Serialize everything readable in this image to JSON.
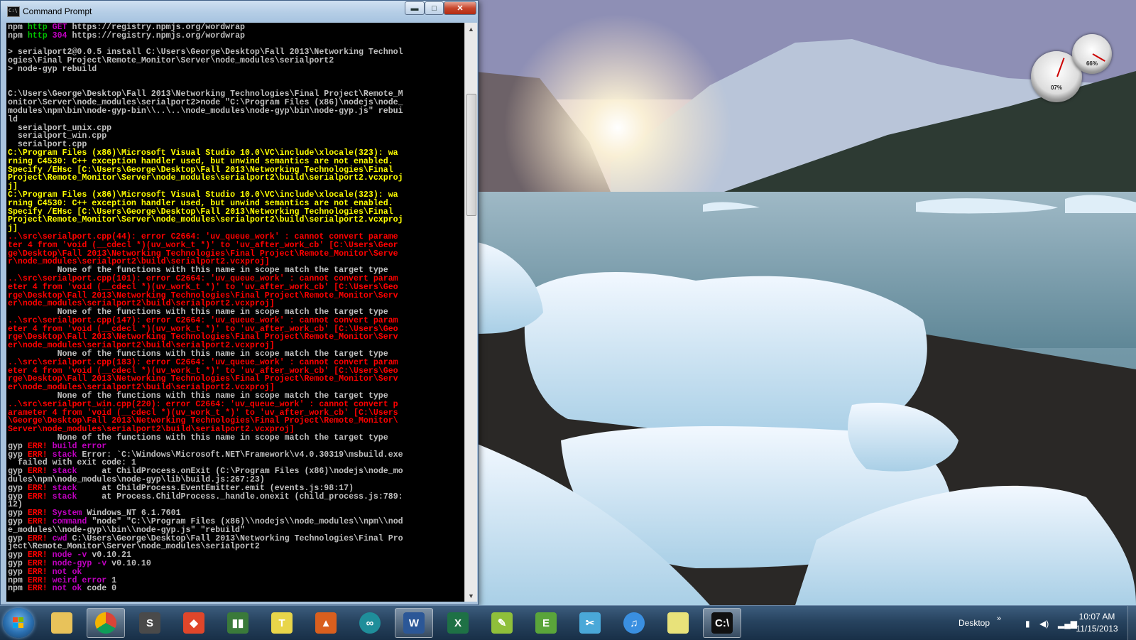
{
  "window": {
    "title": "Command Prompt",
    "minimize_glyph": "▬",
    "maximize_glyph": "□",
    "close_glyph": "✕"
  },
  "console": {
    "lines": [
      [
        [
          "w",
          "npm "
        ],
        [
          "g",
          "http "
        ],
        [
          "m",
          "GET "
        ],
        [
          "w",
          "https://registry.npmjs.org/wordwrap"
        ]
      ],
      [
        [
          "w",
          "npm "
        ],
        [
          "g",
          "http "
        ],
        [
          "m",
          "304 "
        ],
        [
          "w",
          "https://registry.npmjs.org/wordwrap"
        ]
      ],
      [
        [
          "w",
          ""
        ]
      ],
      [
        [
          "w",
          "> serialport2@0.0.5 install C:\\Users\\George\\Desktop\\Fall 2013\\Networking Technol"
        ]
      ],
      [
        [
          "w",
          "ogies\\Final Project\\Remote_Monitor\\Server\\node_modules\\serialport2"
        ]
      ],
      [
        [
          "w",
          "> node-gyp rebuild"
        ]
      ],
      [
        [
          "w",
          ""
        ]
      ],
      [
        [
          "w",
          ""
        ]
      ],
      [
        [
          "w",
          "C:\\Users\\George\\Desktop\\Fall 2013\\Networking Technologies\\Final Project\\Remote_M"
        ]
      ],
      [
        [
          "w",
          "onitor\\Server\\node_modules\\serialport2>node \"C:\\Program Files (x86)\\nodejs\\node_"
        ]
      ],
      [
        [
          "w",
          "modules\\npm\\bin\\node-gyp-bin\\\\..\\..\\node_modules\\node-gyp\\bin\\node-gyp.js\" rebui"
        ]
      ],
      [
        [
          "w",
          "ld"
        ]
      ],
      [
        [
          "w",
          "  serialport_unix.cpp"
        ]
      ],
      [
        [
          "w",
          "  serialport_win.cpp"
        ]
      ],
      [
        [
          "w",
          "  serialport.cpp"
        ]
      ],
      [
        [
          "y",
          "C:\\Program Files (x86)\\Microsoft Visual Studio 10.0\\VC\\include\\xlocale(323): wa"
        ]
      ],
      [
        [
          "y",
          "rning C4530: C++ exception handler used, but unwind semantics are not enabled."
        ]
      ],
      [
        [
          "y",
          "Specify /EHsc [C:\\Users\\George\\Desktop\\Fall 2013\\Networking Technologies\\Final "
        ]
      ],
      [
        [
          "y",
          "Project\\Remote_Monitor\\Server\\node_modules\\serialport2\\build\\serialport2.vcxproj"
        ]
      ],
      [
        [
          "y",
          "j]"
        ]
      ],
      [
        [
          "y",
          "C:\\Program Files (x86)\\Microsoft Visual Studio 10.0\\VC\\include\\xlocale(323): wa"
        ]
      ],
      [
        [
          "y",
          "rning C4530: C++ exception handler used, but unwind semantics are not enabled."
        ]
      ],
      [
        [
          "y",
          "Specify /EHsc [C:\\Users\\George\\Desktop\\Fall 2013\\Networking Technologies\\Final "
        ]
      ],
      [
        [
          "y",
          "Project\\Remote_Monitor\\Server\\node_modules\\serialport2\\build\\serialport2.vcxproj"
        ]
      ],
      [
        [
          "y",
          "j]"
        ]
      ],
      [
        [
          "r",
          "..\\src\\serialport.cpp(44): error C2664: 'uv_queue_work' : cannot convert parame"
        ]
      ],
      [
        [
          "r",
          "ter 4 from 'void (__cdecl *)(uv_work_t *)' to 'uv_after_work_cb' [C:\\Users\\Geor"
        ]
      ],
      [
        [
          "r",
          "ge\\Desktop\\Fall 2013\\Networking Technologies\\Final Project\\Remote_Monitor\\Serve"
        ]
      ],
      [
        [
          "r",
          "r\\node_modules\\serialport2\\build\\serialport2.vcxproj]"
        ]
      ],
      [
        [
          "w",
          "          None of the functions with this name in scope match the target type"
        ]
      ],
      [
        [
          "r",
          "..\\src\\serialport.cpp(101): error C2664: 'uv_queue_work' : cannot convert param"
        ]
      ],
      [
        [
          "r",
          "eter 4 from 'void (__cdecl *)(uv_work_t *)' to 'uv_after_work_cb' [C:\\Users\\Geo"
        ]
      ],
      [
        [
          "r",
          "rge\\Desktop\\Fall 2013\\Networking Technologies\\Final Project\\Remote_Monitor\\Serv"
        ]
      ],
      [
        [
          "r",
          "er\\node_modules\\serialport2\\build\\serialport2.vcxproj]"
        ]
      ],
      [
        [
          "w",
          "          None of the functions with this name in scope match the target type"
        ]
      ],
      [
        [
          "r",
          "..\\src\\serialport.cpp(147): error C2664: 'uv_queue_work' : cannot convert param"
        ]
      ],
      [
        [
          "r",
          "eter 4 from 'void (__cdecl *)(uv_work_t *)' to 'uv_after_work_cb' [C:\\Users\\Geo"
        ]
      ],
      [
        [
          "r",
          "rge\\Desktop\\Fall 2013\\Networking Technologies\\Final Project\\Remote_Monitor\\Serv"
        ]
      ],
      [
        [
          "r",
          "er\\node_modules\\serialport2\\build\\serialport2.vcxproj]"
        ]
      ],
      [
        [
          "w",
          "          None of the functions with this name in scope match the target type"
        ]
      ],
      [
        [
          "r",
          "..\\src\\serialport.cpp(183): error C2664: 'uv_queue_work' : cannot convert param"
        ]
      ],
      [
        [
          "r",
          "eter 4 from 'void (__cdecl *)(uv_work_t *)' to 'uv_after_work_cb' [C:\\Users\\Geo"
        ]
      ],
      [
        [
          "r",
          "rge\\Desktop\\Fall 2013\\Networking Technologies\\Final Project\\Remote_Monitor\\Serv"
        ]
      ],
      [
        [
          "r",
          "er\\node_modules\\serialport2\\build\\serialport2.vcxproj]"
        ]
      ],
      [
        [
          "w",
          "          None of the functions with this name in scope match the target type"
        ]
      ],
      [
        [
          "r",
          "..\\src\\serialport_win.cpp(220): error C2664: 'uv_queue_work' : cannot convert p"
        ]
      ],
      [
        [
          "r",
          "arameter 4 from 'void (__cdecl *)(uv_work_t *)' to 'uv_after_work_cb' [C:\\Users"
        ]
      ],
      [
        [
          "r",
          "\\George\\Desktop\\Fall 2013\\Networking Technologies\\Final Project\\Remote_Monitor\\"
        ]
      ],
      [
        [
          "r",
          "Server\\node_modules\\serialport2\\build\\serialport2.vcxproj]"
        ]
      ],
      [
        [
          "w",
          "          None of the functions with this name in scope match the target type"
        ]
      ],
      [
        [
          "w",
          "gyp "
        ],
        [
          "r",
          "ERR! "
        ],
        [
          "m",
          "build error"
        ]
      ],
      [
        [
          "w",
          "gyp "
        ],
        [
          "r",
          "ERR! "
        ],
        [
          "m",
          "stack "
        ],
        [
          "w",
          "Error: `C:\\Windows\\Microsoft.NET\\Framework\\v4.0.30319\\msbuild.exe"
        ]
      ],
      [
        [
          "w",
          "` failed with exit code: 1"
        ]
      ],
      [
        [
          "w",
          "gyp "
        ],
        [
          "r",
          "ERR! "
        ],
        [
          "m",
          "stack     "
        ],
        [
          "w",
          "at ChildProcess.onExit (C:\\Program Files (x86)\\nodejs\\node_mo"
        ]
      ],
      [
        [
          "w",
          "dules\\npm\\node_modules\\node-gyp\\lib\\build.js:267:23)"
        ]
      ],
      [
        [
          "w",
          "gyp "
        ],
        [
          "r",
          "ERR! "
        ],
        [
          "m",
          "stack     "
        ],
        [
          "w",
          "at ChildProcess.EventEmitter.emit (events.js:98:17)"
        ]
      ],
      [
        [
          "w",
          "gyp "
        ],
        [
          "r",
          "ERR! "
        ],
        [
          "m",
          "stack     "
        ],
        [
          "w",
          "at Process.ChildProcess._handle.onexit (child_process.js:789:"
        ]
      ],
      [
        [
          "w",
          "12)"
        ]
      ],
      [
        [
          "w",
          "gyp "
        ],
        [
          "r",
          "ERR! "
        ],
        [
          "m",
          "System "
        ],
        [
          "w",
          "Windows_NT 6.1.7601"
        ]
      ],
      [
        [
          "w",
          "gyp "
        ],
        [
          "r",
          "ERR! "
        ],
        [
          "m",
          "command "
        ],
        [
          "w",
          "\"node\" \"C:\\\\Program Files (x86)\\\\nodejs\\\\node_modules\\\\npm\\\\nod"
        ]
      ],
      [
        [
          "w",
          "e_modules\\\\node-gyp\\\\bin\\\\node-gyp.js\" \"rebuild\""
        ]
      ],
      [
        [
          "w",
          "gyp "
        ],
        [
          "r",
          "ERR! "
        ],
        [
          "m",
          "cwd "
        ],
        [
          "w",
          "C:\\Users\\George\\Desktop\\Fall 2013\\Networking Technologies\\Final Pro"
        ]
      ],
      [
        [
          "w",
          "ject\\Remote_Monitor\\Server\\node_modules\\serialport2"
        ]
      ],
      [
        [
          "w",
          "gyp "
        ],
        [
          "r",
          "ERR! "
        ],
        [
          "m",
          "node -v "
        ],
        [
          "w",
          "v0.10.21"
        ]
      ],
      [
        [
          "w",
          "gyp "
        ],
        [
          "r",
          "ERR! "
        ],
        [
          "m",
          "node-gyp -v "
        ],
        [
          "w",
          "v0.10.10"
        ]
      ],
      [
        [
          "w",
          "gyp "
        ],
        [
          "r",
          "ERR! "
        ],
        [
          "m",
          "not ok"
        ]
      ],
      [
        [
          "w",
          "npm "
        ],
        [
          "r",
          "ERR! "
        ],
        [
          "m",
          "weird error "
        ],
        [
          "w",
          "1"
        ]
      ],
      [
        [
          "w",
          "npm "
        ],
        [
          "r",
          "ERR! "
        ],
        [
          "m",
          "not ok "
        ],
        [
          "w",
          "code 0"
        ]
      ]
    ]
  },
  "gadget": {
    "cpu_percent": "07%",
    "memory_percent": "66%"
  },
  "taskbar": {
    "items": [
      {
        "name": "explorer",
        "label": "",
        "icon": "folder-icon",
        "color": "#e8c25a",
        "active": false
      },
      {
        "name": "chrome",
        "label": "",
        "icon": "chrome-icon",
        "color": "#e33b2e",
        "active": true
      },
      {
        "name": "sublime",
        "label": "S",
        "icon": "sublime-text-icon",
        "color": "#4a4a4a",
        "active": false
      },
      {
        "name": "git",
        "label": "◆",
        "icon": "git-icon",
        "color": "#e0462a",
        "active": false
      },
      {
        "name": "network",
        "label": "▮▮",
        "icon": "network-monitor-icon",
        "color": "#3a7a3a",
        "active": false
      },
      {
        "name": "textpad",
        "label": "T",
        "icon": "textpad-icon",
        "color": "#e8d54a",
        "active": false
      },
      {
        "name": "matlab",
        "label": "▲",
        "icon": "matlab-icon",
        "color": "#d95f1e",
        "active": false
      },
      {
        "name": "arduino",
        "label": "∞",
        "icon": "arduino-icon",
        "color": "#1f8e9a",
        "active": false
      },
      {
        "name": "word",
        "label": "W",
        "icon": "word-icon",
        "color": "#2b5797",
        "active": true
      },
      {
        "name": "excel",
        "label": "X",
        "icon": "excel-icon",
        "color": "#1e7145",
        "active": false
      },
      {
        "name": "notepad",
        "label": "✎",
        "icon": "notepad-plus-icon",
        "color": "#8fbf3a",
        "active": false
      },
      {
        "name": "evernote",
        "label": "E",
        "icon": "evernote-icon",
        "color": "#5aa53a",
        "active": false
      },
      {
        "name": "snipping",
        "label": "✂",
        "icon": "snipping-tool-icon",
        "color": "#4aa8d8",
        "active": false
      },
      {
        "name": "itunes",
        "label": "♫",
        "icon": "itunes-icon",
        "color": "#3a8fe0",
        "active": false
      },
      {
        "name": "sticky",
        "label": "",
        "icon": "sticky-notes-icon",
        "color": "#e8e27a",
        "active": false
      },
      {
        "name": "cmd",
        "label": "C:\\",
        "icon": "command-prompt-icon",
        "color": "#111111",
        "active": true
      }
    ],
    "desktop_label": "Desktop",
    "chevron": "»",
    "clock_time": "10:07 AM",
    "clock_date": "11/15/2013"
  }
}
